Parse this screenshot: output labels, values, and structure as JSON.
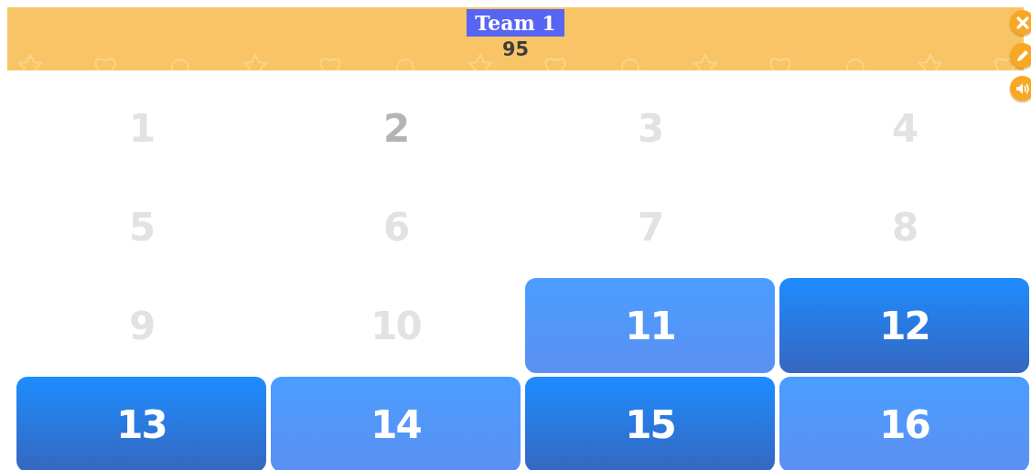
{
  "header": {
    "team": "Team 1",
    "score": "95"
  },
  "tools": [
    {
      "kind": "close"
    },
    {
      "kind": "edit"
    },
    {
      "kind": "sound"
    }
  ],
  "tiles": [
    {
      "label": "1",
      "kind": "revealed"
    },
    {
      "label": "2",
      "kind": "current"
    },
    {
      "label": "3",
      "kind": "revealed"
    },
    {
      "label": "4",
      "kind": "revealed"
    },
    {
      "label": "5",
      "kind": "revealed"
    },
    {
      "label": "6",
      "kind": "revealed"
    },
    {
      "label": "7",
      "kind": "revealed"
    },
    {
      "label": "8",
      "kind": "revealed"
    },
    {
      "label": "9",
      "kind": "revealed"
    },
    {
      "label": "10",
      "kind": "revealed"
    },
    {
      "label": "11",
      "kind": "light"
    },
    {
      "label": "12",
      "kind": "dark"
    },
    {
      "label": "13",
      "kind": "dark"
    },
    {
      "label": "14",
      "kind": "light"
    },
    {
      "label": "15",
      "kind": "dark"
    },
    {
      "label": "16",
      "kind": "light"
    }
  ]
}
